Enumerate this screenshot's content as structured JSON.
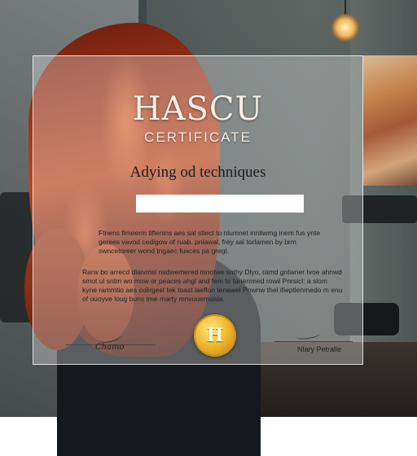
{
  "certificate": {
    "title": "HASCU",
    "subtitle": "CERTIFICATE",
    "course": "Adying od techniques",
    "recipient_name": "",
    "paragraph_1": "Ftnens fimeerm tiflenins aes sal stiect to nlumnet innliwmg inem fus ynte gerees vavod cedigow of ruab. pnlawal, frey sal torlamen by brm swncetoreer wond tngaec fuaces pa gregl.",
    "paragraph_2": "Rarw bo arrecd dlaivmsl nsdwemered mnotwe snthy Dlyo, ramd gntwner Ivoe ahnwd smot ul sntm wo mow or peaces ahgl and fem to tanerrmed rowil Pnrsicl: a slom kyne rammtio aes colirgest tek toast laeflon tenawel Pnwnw thel ifieptlenmedo m enu of ouoyve loug buns tme marty mnvuuemsisia.",
    "signature_left_label": "Chamo",
    "signature_right_label": "Nlary Petralle",
    "seal_letter": "H"
  }
}
